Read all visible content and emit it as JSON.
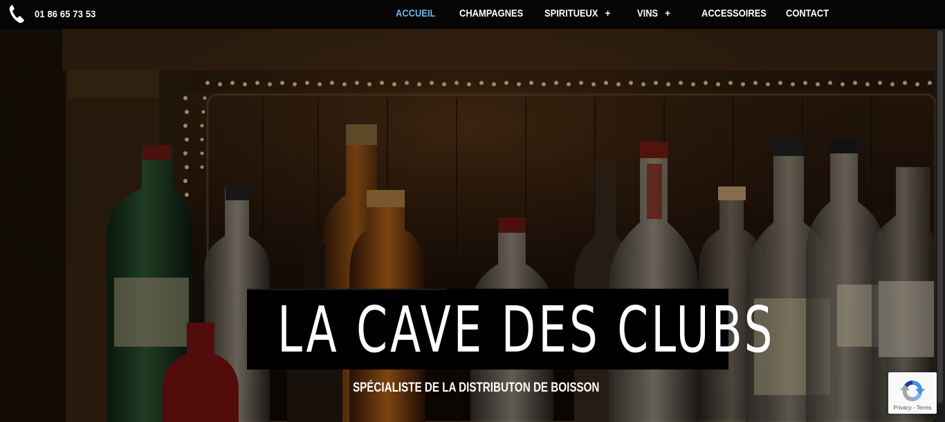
{
  "header": {
    "phone": "01 86 65 73 53",
    "phone_icon": "phone-icon",
    "nav": [
      {
        "label": "ACCUEIL",
        "active": true,
        "has_submenu": false
      },
      {
        "label": "CHAMPAGNES",
        "active": false,
        "has_submenu": false
      },
      {
        "label": "SPIRITUEUX",
        "active": false,
        "has_submenu": true
      },
      {
        "label": "VINS",
        "active": false,
        "has_submenu": true
      },
      {
        "label": "ACCESSOIRES",
        "active": false,
        "has_submenu": false
      },
      {
        "label": "CONTACT",
        "active": false,
        "has_submenu": false
      }
    ],
    "submenu_glyph": "+"
  },
  "hero": {
    "title": "LA CAVE DES CLUBS",
    "subtitle": "SPÉCIALISTE DE LA DISTRIBUTON DE BOISSON",
    "background": "bar shelf with liquor bottles lit by string lights"
  },
  "recaptcha": {
    "links": "Privacy - Terms"
  },
  "colors": {
    "active_nav": "#6db2e6",
    "topbar": "#050505",
    "text": "#ffffff"
  }
}
